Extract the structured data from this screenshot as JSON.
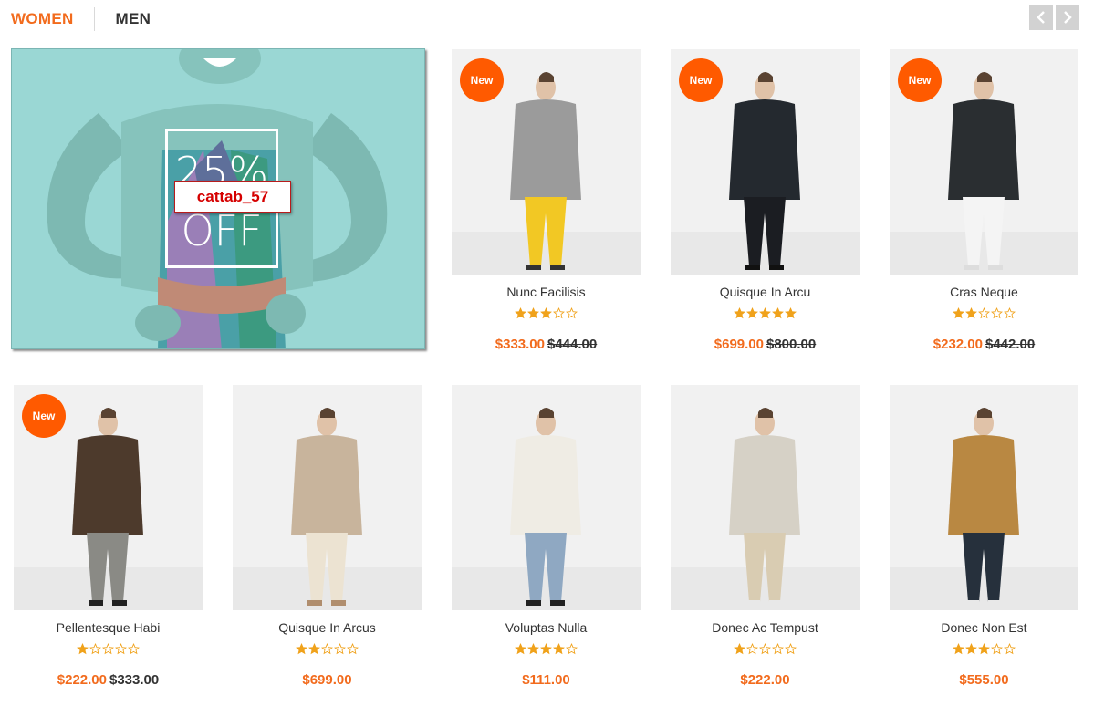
{
  "tabs": [
    {
      "label": "WOMEN",
      "active": true
    },
    {
      "label": "MEN",
      "active": false
    }
  ],
  "nav": {
    "prev_icon": "chevron-left-icon",
    "next_icon": "chevron-right-icon"
  },
  "banner": {
    "promo_line1": "25%",
    "promo_line2": "OFF",
    "overlay_label": "cattab_57"
  },
  "badge_text": "New",
  "colors": {
    "accent": "#f26b1d",
    "badge": "#ff5a00",
    "star": "#f0a21b",
    "banner_bg": "#9ad7d4"
  },
  "products": [
    {
      "name": "Nunc Facilisis",
      "price": "$333.00",
      "old_price": "$444.00",
      "rating": 3,
      "is_new": true
    },
    {
      "name": "Quisque In Arcu",
      "price": "$699.00",
      "old_price": "$800.00",
      "rating": 5,
      "is_new": true
    },
    {
      "name": "Cras Neque",
      "price": "$232.00",
      "old_price": "$442.00",
      "rating": 2,
      "is_new": true
    },
    {
      "name": "Pellentesque Habi",
      "price": "$222.00",
      "old_price": "$333.00",
      "rating": 1,
      "is_new": true
    },
    {
      "name": "Quisque In Arcus",
      "price": "$699.00",
      "old_price": "",
      "rating": 2,
      "is_new": false
    },
    {
      "name": "Voluptas Nulla",
      "price": "$111.00",
      "old_price": "",
      "rating": 4,
      "is_new": false
    },
    {
      "name": "Donec Ac Tempust",
      "price": "$222.00",
      "old_price": "",
      "rating": 1,
      "is_new": false
    },
    {
      "name": "Donec Non Est",
      "price": "$555.00",
      "old_price": "",
      "rating": 3,
      "is_new": false
    }
  ]
}
